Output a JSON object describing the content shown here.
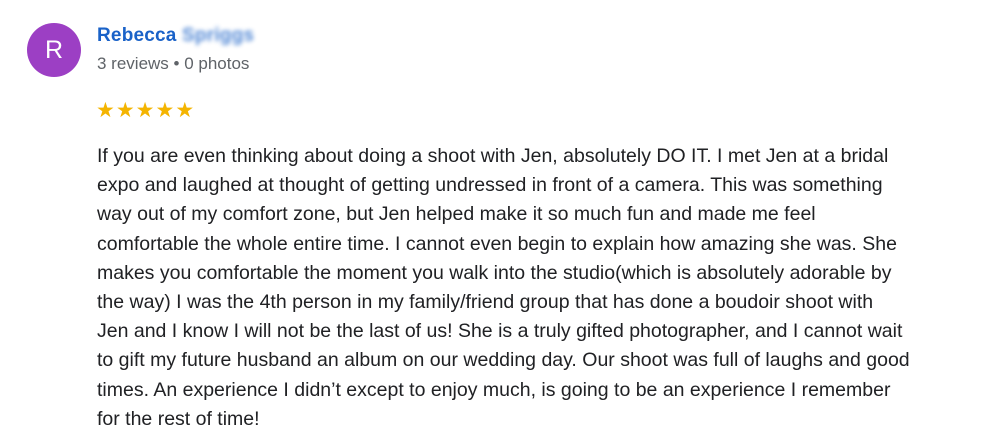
{
  "colors": {
    "avatar_bg": "#9c3fc4",
    "name": "#1a62c8",
    "star": "#f4b400"
  },
  "review": {
    "avatar_initial": "R",
    "reviewer_name_visible": "Rebecca",
    "reviewer_name_obscured": "Spriggs",
    "reviewer_meta": "3 reviews • 0 photos",
    "rating": 5,
    "rating_max": 5,
    "star_glyph": "★",
    "text_lines": [
      "If you are even thinking about doing a shoot with Jen, absolutely DO IT. I met Jen at a bridal",
      "expo and laughed at thought of getting undressed in front of a camera. This was something",
      "way out of my comfort zone, but Jen helped make it so much fun and made me feel",
      "comfortable the whole entire time. I cannot even begin to explain how amazing she was. She",
      "makes you comfortable the moment you walk into the studio(which is absolutely adorable by",
      "the way) I was the 4th person in my family/friend group that has done a boudoir shoot with",
      "Jen and I know I will not be the last of us! She is a truly gifted photographer, and I cannot wait",
      "to gift my future husband an album on our wedding day. Our shoot was full of laughs and good",
      "times. An experience I didn’t except to enjoy much, is going to be an experience I remember",
      "for the rest of time!"
    ]
  }
}
